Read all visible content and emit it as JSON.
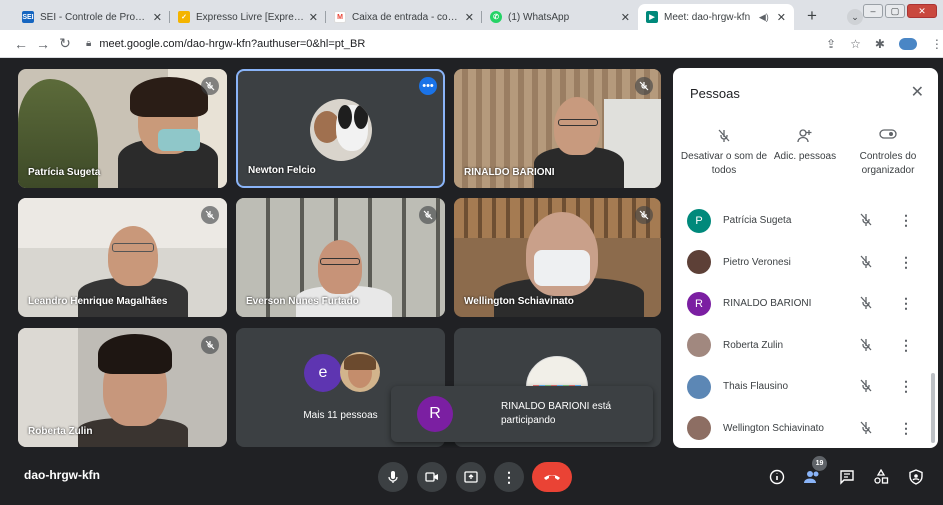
{
  "browser": {
    "tabs": [
      {
        "favicon": "sei-icon",
        "favicon_text": "SEI",
        "favicon_color": "#1565c0",
        "title": "SEI - Controle de Processos",
        "close": "✕"
      },
      {
        "favicon": "expresso-icon",
        "favicon_text": "✓",
        "favicon_color": "#f4b400",
        "title": "Expresso Livre [Expresso Mail]",
        "close": "✕"
      },
      {
        "favicon": "gmail-icon",
        "favicon_text": "M",
        "favicon_color": "#ea4335",
        "title": "Caixa de entrada - comtur@",
        "close": "✕"
      },
      {
        "favicon": "whatsapp-icon",
        "favicon_text": "✆",
        "favicon_color": "#25d366",
        "title": "(1) WhatsApp",
        "close": "✕"
      },
      {
        "favicon": "meet-icon",
        "favicon_text": "▶",
        "favicon_color": "#00897b",
        "title": "Meet: dao-hrgw-kfn",
        "close": "✕",
        "active": true
      }
    ],
    "new_tab": "+",
    "url": "meet.google.com/dao-hrgw-kfn?authuser=0&hl=pt_BR"
  },
  "tiles": [
    {
      "name": "Patrícia Sugeta",
      "muted": true
    },
    {
      "name": "Newton Felcio",
      "muted": false,
      "selected": true
    },
    {
      "name": "RINALDO BARIONI",
      "muted": true
    },
    {
      "name": "Leandro Henrique Magalhães",
      "muted": true
    },
    {
      "name": "Everson Nunes Furtado",
      "muted": true
    },
    {
      "name": "Wellington Schiavinato",
      "muted": true
    },
    {
      "name": "Roberta Zulin",
      "muted": true
    },
    {
      "name": "Mais 11 pessoas",
      "avatar_letter": "e"
    }
  ],
  "people_panel": {
    "title": "Pessoas",
    "actions": [
      {
        "icon": "mic-off-icon",
        "label": "Desativar o som de todos"
      },
      {
        "icon": "add-person-icon",
        "label": "Adic. pessoas"
      },
      {
        "icon": "toggle-icon",
        "label": "Controles do organizador"
      }
    ],
    "people": [
      {
        "name": "Patrícia Sugeta",
        "avatar_letter": "P",
        "avatar_color": "#00897b"
      },
      {
        "name": "Pietro Veronesi",
        "avatar_letter": "",
        "avatar_color": "#5d4037"
      },
      {
        "name": "RINALDO BARIONI",
        "avatar_letter": "R",
        "avatar_color": "#7b1fa2"
      },
      {
        "name": "Roberta Zulin",
        "avatar_letter": "",
        "avatar_color": "#a1887f"
      },
      {
        "name": "Thais Flausino",
        "avatar_letter": "",
        "avatar_color": "#5c87b5"
      },
      {
        "name": "Wellington Schiavinato",
        "avatar_letter": "",
        "avatar_color": "#8d6e63"
      }
    ]
  },
  "toast": {
    "avatar_letter": "R",
    "message": "RINALDO BARIONI está participando"
  },
  "bottom": {
    "meeting_code": "dao-hrgw-kfn",
    "participants_count": "19"
  },
  "colors": {
    "end_call": "#ea4335",
    "accent": "#1a73e8",
    "bg": "#202124"
  }
}
